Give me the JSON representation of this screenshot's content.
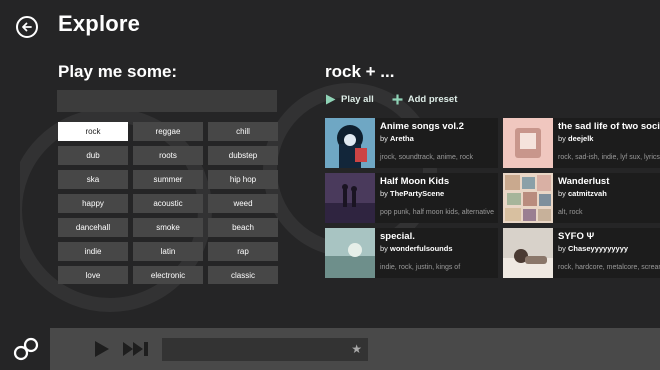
{
  "header": {
    "title": "Explore"
  },
  "left": {
    "heading": "Play me some:",
    "search_value": "",
    "genres": [
      {
        "label": "rock",
        "selected": true
      },
      {
        "label": "reggae"
      },
      {
        "label": "chill"
      },
      {
        "label": "dub"
      },
      {
        "label": "roots"
      },
      {
        "label": "dubstep"
      },
      {
        "label": "ska"
      },
      {
        "label": "summer"
      },
      {
        "label": "hip hop"
      },
      {
        "label": "happy"
      },
      {
        "label": "acoustic"
      },
      {
        "label": "weed"
      },
      {
        "label": "dancehall"
      },
      {
        "label": "smoke"
      },
      {
        "label": "beach"
      },
      {
        "label": "indie"
      },
      {
        "label": "latin"
      },
      {
        "label": "rap"
      },
      {
        "label": "love"
      },
      {
        "label": "electronic"
      },
      {
        "label": "classic"
      }
    ]
  },
  "right": {
    "heading": "rock + ...",
    "play_all_label": "Play all",
    "add_preset_label": "Add preset",
    "playlists": [
      {
        "title": "Anime songs vol.2",
        "by_label": "by",
        "author": "Aretha",
        "tags": "jrock, soundtrack, anime, rock",
        "thumb": "anime"
      },
      {
        "title": "the sad life of two socials",
        "by_label": "by",
        "author": "deejelk",
        "tags": "rock, sad-ish, indie, lyf sux, lyrics",
        "thumb": "pink"
      },
      {
        "title": "Half Moon Kids",
        "by_label": "by",
        "author": "ThePartyScene",
        "tags": "pop punk, half moon kids, alternative",
        "thumb": "purple"
      },
      {
        "title": "Wanderlust",
        "by_label": "by",
        "author": "catmitzvah",
        "tags": "alt, rock",
        "thumb": "collage"
      },
      {
        "title": "special.",
        "by_label": "by",
        "author": "wonderfulsounds",
        "tags": "indie, rock, justin, kings of",
        "thumb": "teal"
      },
      {
        "title": "SYFO Ψ",
        "by_label": "by",
        "author": "Chaseyyyyyyyyy",
        "tags": "rock, hardcore, metalcore, screamo",
        "thumb": "bed"
      }
    ]
  },
  "player": {
    "track_text": ""
  },
  "colors": {
    "background": "#252526",
    "tile": "#474747",
    "tile_selected": "#ffffff",
    "accent": "#8fd3b6",
    "player_bar": "#494949"
  }
}
